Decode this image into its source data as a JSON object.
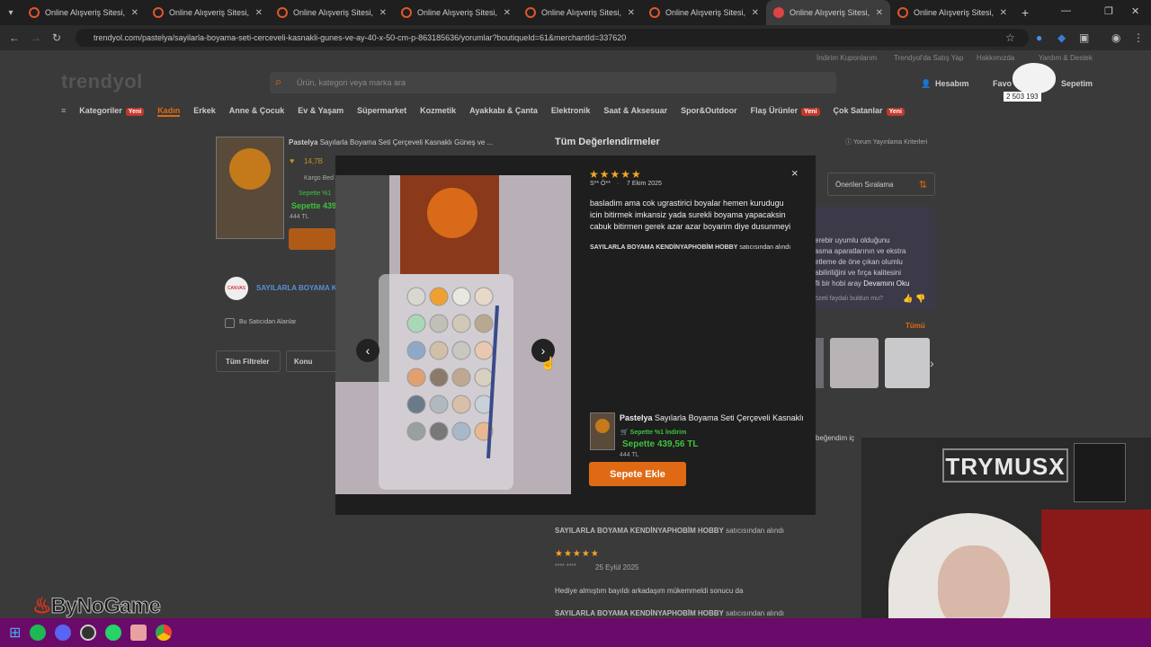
{
  "tabs": [
    {
      "title": "Online Alışveriş Sitesi, Tü",
      "active": false
    },
    {
      "title": "Online Alışveriş Sitesi, Tü",
      "active": false
    },
    {
      "title": "Online Alışveriş Sitesi, Tü",
      "active": false
    },
    {
      "title": "Online Alışveriş Sitesi, Tü",
      "active": false
    },
    {
      "title": "Online Alışveriş Sitesi, Tü",
      "active": false
    },
    {
      "title": "Online Alışveriş Sitesi, Tü",
      "active": false
    },
    {
      "title": "Online Alışveriş Sitesi, Tür",
      "active": true
    },
    {
      "title": "Online Alışveriş Sitesi, Tü",
      "active": false
    }
  ],
  "url": "trendyol.com/pastelya/sayilarla-boyama-seti-cerceveli-kasnakli-gunes-ve-ay-40-x-50-cm-p-863185636/yorumlar?boutiqueId=61&merchantId=337620",
  "header": {
    "links": [
      "İndirim Kuponlarım",
      "Trendyol'da Satış Yap",
      "Hakkımızda",
      "Yardım & Destek"
    ],
    "logo": "trendyol",
    "search_placeholder": "Ürün, kategori veya marka ara",
    "account": "Hesabım",
    "favorites": "Favo",
    "cart": "Sepetim",
    "counter": "2 503 193"
  },
  "nav": [
    {
      "label": "Kategoriler",
      "badge": "Yeni"
    },
    {
      "label": "Kadın",
      "badge": ""
    },
    {
      "label": "Erkek",
      "badge": ""
    },
    {
      "label": "Anne & Çocuk",
      "badge": ""
    },
    {
      "label": "Ev & Yaşam",
      "badge": ""
    },
    {
      "label": "Süpermarket",
      "badge": ""
    },
    {
      "label": "Kozmetik",
      "badge": ""
    },
    {
      "label": "Ayakkabı & Çanta",
      "badge": ""
    },
    {
      "label": "Elektronik",
      "badge": ""
    },
    {
      "label": "Saat & Aksesuar",
      "badge": ""
    },
    {
      "label": "Spor&Outdoor",
      "badge": ""
    },
    {
      "label": "Flaş Ürünler",
      "badge": "Yeni"
    },
    {
      "label": "Çok Satanlar",
      "badge": "Yeni"
    }
  ],
  "left_panel": {
    "brand": "Pastelya",
    "product_title": "Sayılarla Boyama Seti Çerçeveli Kasnaklı Güneş ve ...",
    "likes": "14,7B",
    "kargo": "Kargo Bed",
    "discount": "Sepette %1",
    "price_cart": "Sepette 439",
    "price_old": "444 TL",
    "seller_name": "SAYILARLA BOYAMA KE",
    "seller_logo": "CANVAS",
    "filter_check": "Bu Satıcıdan Alanlar",
    "btn_filters": "Tüm Filtreler",
    "btn_topic": "Konu"
  },
  "reviews_panel": {
    "title": "Tüm Değerlendirmeler",
    "criteria": "Yorum Yayınlama Kriterleri",
    "sort": "Önerilen Sıralama",
    "summary_lines": [
      "erebir uyumlu olduğunu",
      "asma aparatlarının ve ekstra",
      "etleme de öne çıkan olumlu",
      "abiliriliğini ve fırça kalitesini",
      "fli bir hobi aray"
    ],
    "read_more": "Devamını Oku",
    "helpful_q": "özeti faydalı buldun mu?",
    "see_all": "Tümü",
    "partial": "beğendim iç"
  },
  "modal": {
    "stars": "★★★★★",
    "reviewer": "S** Ö**",
    "date": "7 Ekim 2025",
    "text": "basladim ama cok ugrastirici boyalar hemen kurudugu icin bitirmek imkansiz yada surekli boyama yapacaksin cabuk bitirmen gerek azar azar boyarim diye dusunmeyi",
    "seller_bold": "SAYILARLA BOYAMA KENDİNYAPHOBİM HOBBY",
    "seller_suffix": " satıcısından alındı",
    "close": "×",
    "prev": "‹",
    "next": "›",
    "product_brand": "Pastelya",
    "product_name": "Sayılarla Boyama Seti Çerçeveli Kasnaklı...",
    "discount": "Sepette %1 İndirim",
    "price": "Sepette 439,56 TL",
    "old_price": "444 TL",
    "add_to_cart": "Sepete Ekle"
  },
  "below_reviews": [
    {
      "seller_bold": "SAYILARLA BOYAMA KENDİNYAPHOBİM HOBBY",
      "seller_suffix": " satıcısından alındı"
    },
    {
      "stars": "★★★★★",
      "reviewer": "**** ****",
      "date": "25 Eylül 2025",
      "text": "Hediye almıştım bayıldı arkadaşım mükemmeldi sonucu da",
      "seller_bold": "SAYILARLA BOYAMA KENDİNYAPHOBİM HOBBY",
      "seller_suffix": " satıcısından alındı"
    }
  ],
  "overlay": {
    "brand_watermark": "ByNoGame",
    "webcam_sign": "TRYMUSX"
  },
  "colors": {
    "accent": "#e06a14",
    "green": "#3ec23e",
    "star": "#f5a623",
    "taskbar": "#6a0a6a"
  }
}
